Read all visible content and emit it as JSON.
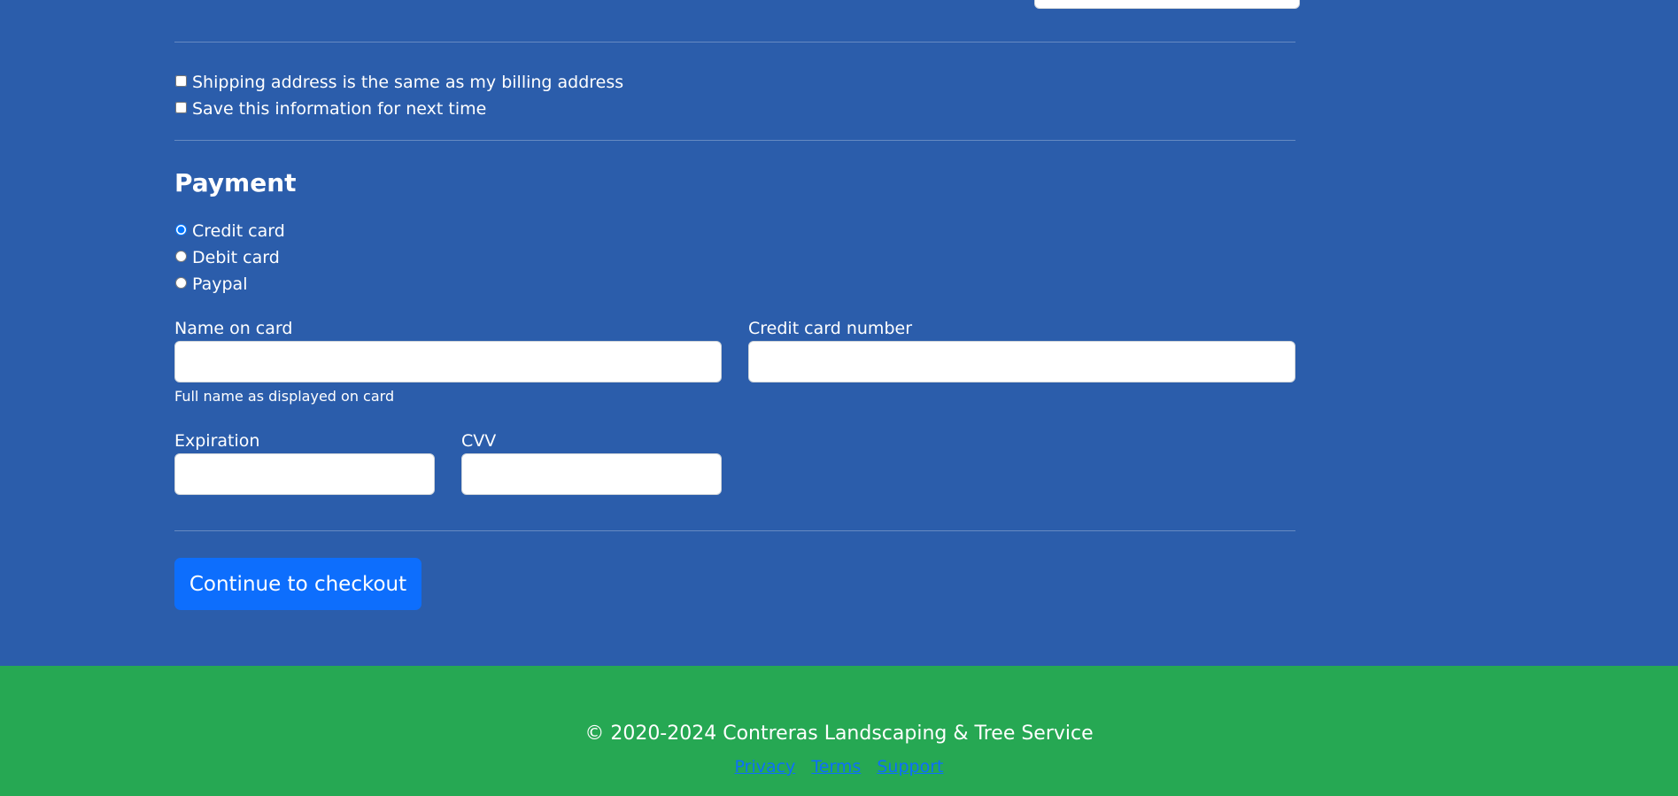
{
  "options": {
    "same_address_label": "Shipping address is the same as my billing address",
    "save_info_label": "Save this information for next time"
  },
  "payment": {
    "title": "Payment",
    "methods": [
      {
        "label": "Credit card",
        "checked": true
      },
      {
        "label": "Debit card",
        "checked": false
      },
      {
        "label": "Paypal",
        "checked": false
      }
    ],
    "name_on_card": {
      "label": "Name on card",
      "value": "",
      "help": "Full name as displayed on card"
    },
    "card_number": {
      "label": "Credit card number",
      "value": ""
    },
    "expiration": {
      "label": "Expiration",
      "value": ""
    },
    "cvv": {
      "label": "CVV",
      "value": ""
    },
    "submit_label": "Continue to checkout"
  },
  "footer": {
    "copyright": "© 2020-2024 Contreras Landscaping & Tree Service",
    "links": [
      {
        "label": "Privacy"
      },
      {
        "label": "Terms"
      },
      {
        "label": "Support"
      }
    ]
  },
  "colors": {
    "background": "#2b5dab",
    "footer": "#26a853",
    "primary": "#0d6efd"
  }
}
